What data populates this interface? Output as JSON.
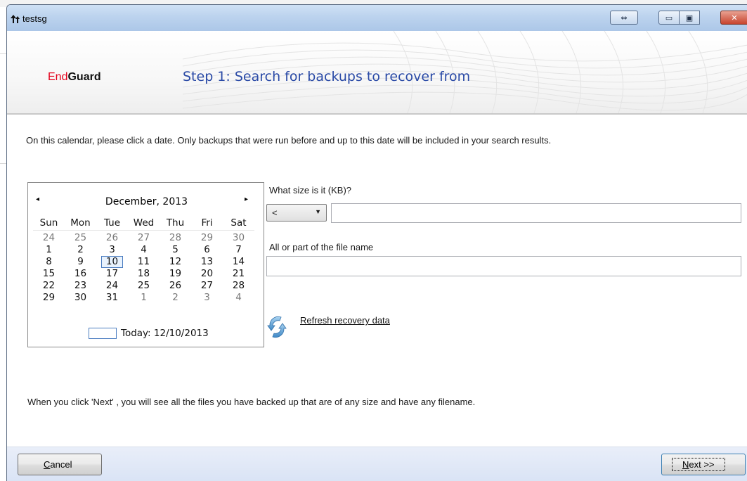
{
  "window": {
    "title": "testsg",
    "restore_glyph": "⇔",
    "min_glyph": "▭",
    "max_glyph": "▣",
    "close_glyph": "✕"
  },
  "header": {
    "brand_part1": "End",
    "brand_part2": "Guard",
    "step_title": "Step 1: Search for backups to recover from"
  },
  "instructions": "On this calendar, please click a date. Only backups that were run before and up to this date will be included in your search results.",
  "calendar": {
    "prev_glyph": "◂",
    "next_glyph": "▸",
    "month_label": "December, 2013",
    "weekdays": [
      "Sun",
      "Mon",
      "Tue",
      "Wed",
      "Thu",
      "Fri",
      "Sat"
    ],
    "weeks": [
      [
        "24",
        "25",
        "26",
        "27",
        "28",
        "29",
        "30"
      ],
      [
        "1",
        "2",
        "3",
        "4",
        "5",
        "6",
        "7"
      ],
      [
        "8",
        "9",
        "10",
        "11",
        "12",
        "13",
        "14"
      ],
      [
        "15",
        "16",
        "17",
        "18",
        "19",
        "20",
        "21"
      ],
      [
        "22",
        "23",
        "24",
        "25",
        "26",
        "27",
        "28"
      ],
      [
        "29",
        "30",
        "31",
        "1",
        "2",
        "3",
        "4"
      ]
    ],
    "today_label": "Today: 12/10/2013"
  },
  "size_filter": {
    "label": "What size is it (KB)?",
    "operator": "<",
    "value": ""
  },
  "name_filter": {
    "label": "All or part of the file name",
    "value": ""
  },
  "refresh_link": "Refresh recovery data",
  "footer_note": "When you click 'Next' , you will see all the files you have backed up that are of any size and have any filename.",
  "buttons": {
    "cancel_access": "C",
    "cancel_rest": "ancel",
    "next_access": "N",
    "next_rest": "ext >>"
  }
}
